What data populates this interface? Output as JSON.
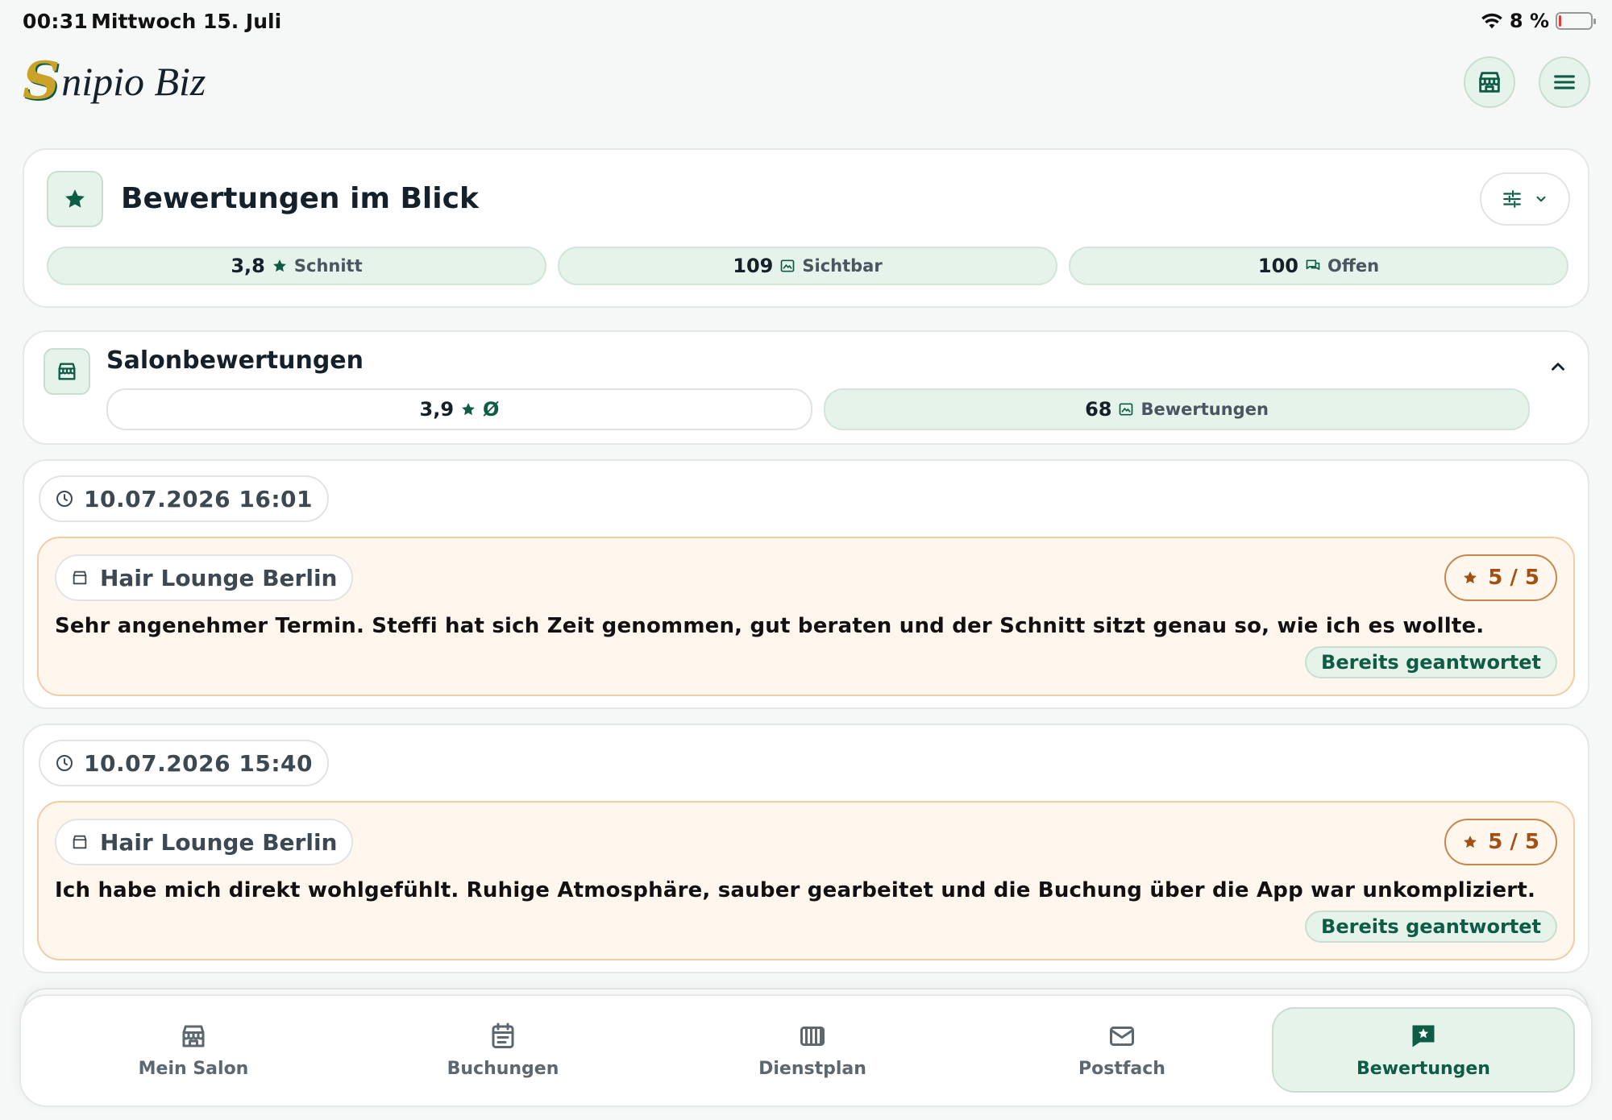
{
  "status_bar": {
    "time": "00:31",
    "date": "Mittwoch 15. Juli",
    "battery": "8 %",
    "battery_level": 0.08
  },
  "header": {
    "logo_initial": "S",
    "logo_rest": "nipio Biz"
  },
  "overview": {
    "title": "Bewertungen im Blick",
    "stats": [
      {
        "value": "3,8",
        "label": "Schnitt"
      },
      {
        "value": "109",
        "label": "Sichtbar"
      },
      {
        "value": "100",
        "label": "Offen"
      }
    ]
  },
  "salon_section": {
    "title": "Salonbewertungen",
    "avg_value": "3,9",
    "avg_symbol": "Ø",
    "count_value": "68",
    "count_label": "Bewertungen"
  },
  "reviews": [
    {
      "datetime": "10.07.2026 16:01",
      "salon": "Hair Lounge Berlin",
      "rating": "5 / 5",
      "rating_value": 5,
      "text": "Sehr angenehmer Termin. Steffi hat sich Zeit genommen, gut beraten und der Schnitt sitzt genau so, wie ich es wollte.",
      "status": "Bereits geantwortet"
    },
    {
      "datetime": "10.07.2026 15:40",
      "salon": "Hair Lounge Berlin",
      "rating": "5 / 5",
      "rating_value": 5,
      "text": "Ich habe mich direkt wohlgefühlt. Ruhige Atmosphäre, sauber gearbeitet und die Buchung über die App war unkompliziert.",
      "status": "Bereits geantwortet"
    }
  ],
  "bottom_nav": [
    {
      "label": "Mein Salon",
      "icon": "store-icon",
      "active": false
    },
    {
      "label": "Buchungen",
      "icon": "calendar-icon",
      "active": false
    },
    {
      "label": "Dienstplan",
      "icon": "schedule-icon",
      "active": false
    },
    {
      "label": "Postfach",
      "icon": "mail-icon",
      "active": false
    },
    {
      "label": "Bewertungen",
      "icon": "review-icon",
      "active": true
    }
  ],
  "colors": {
    "accent": "#0e5c46",
    "accent_light": "#e6f3ea",
    "rating": "#a44f12",
    "review_bg": "#fff6ee",
    "review_border": "#f0cda3"
  }
}
